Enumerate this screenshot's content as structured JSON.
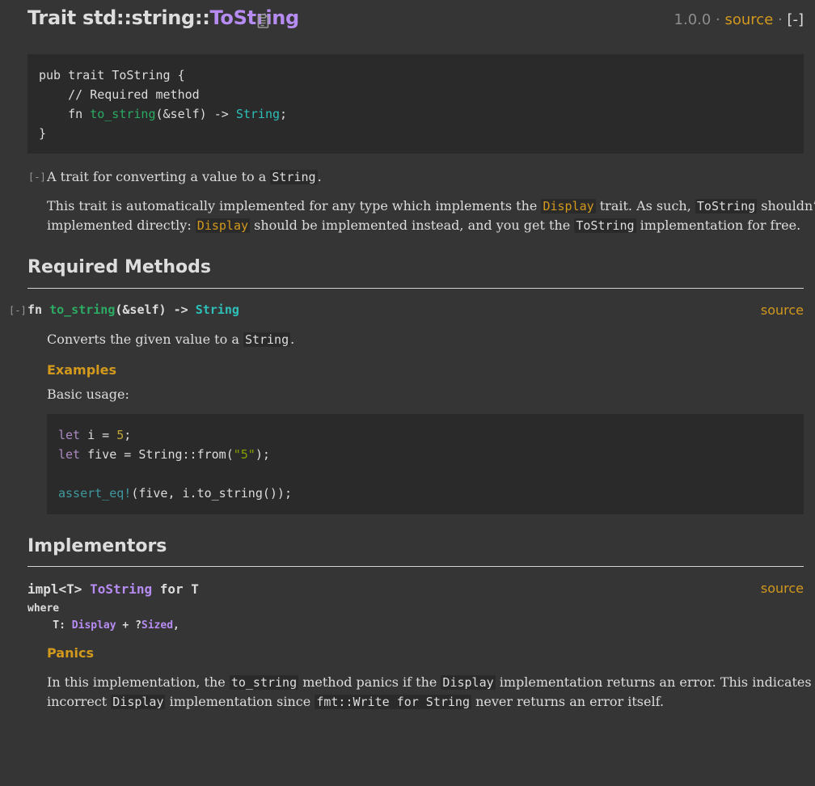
{
  "header": {
    "title_prefix": "Trait std::string::",
    "title_name": "ToString",
    "version": "1.0.0",
    "sep1": " · ",
    "source_label": "source",
    "sep2": " · ",
    "collapse_label": "[-]"
  },
  "declaration": {
    "line1": "pub trait ToString {",
    "line2_comment": "    // Required method",
    "line3_fn": "    fn ",
    "line3_name": "to_string",
    "line3_args": "(&self) -> ",
    "line3_ret": "String",
    "line3_end": ";",
    "line4": "}"
  },
  "description": {
    "toggle": "[-]",
    "summary_a": "A trait for converting a value to a ",
    "summary_code": "String",
    "summary_b": ".",
    "p1_a": "This trait is automatically implemented for any type which implements the ",
    "p1_code1": "Display",
    "p1_b": " trait. As such, ",
    "p1_code2": "ToString",
    "p1_c": " shouldn’t be",
    "p1_d": "implemented directly: ",
    "p1_code3": "Display",
    "p1_e": " should be implemented instead, and you get the ",
    "p1_code4": "ToString",
    "p1_f": " implementation for free."
  },
  "required_methods": {
    "heading": "Required Methods",
    "toggle": "[-]",
    "sig_fn": "fn ",
    "sig_name": "to_string",
    "sig_args": "(&self) -> ",
    "sig_ret": "String",
    "source_label": "source",
    "doc_a": "Converts the given value to a ",
    "doc_code": "String",
    "doc_b": ".",
    "examples_heading": "Examples",
    "basic_usage": "Basic usage:",
    "code": {
      "l1_let": "let",
      "l1_mid": " i = ",
      "l1_num": "5",
      "l1_end": ";",
      "l2_let": "let",
      "l2_mid": " five = String::from(",
      "l2_str": "\"5\"",
      "l2_end": ");",
      "l4_mac": "assert_eq!",
      "l4_rest": "(five, i.to_string());"
    }
  },
  "implementors": {
    "heading": "Implementors",
    "impl_a": "impl<T> ",
    "impl_trait": "ToString",
    "impl_b": " for T",
    "source_label": "source",
    "where_kw": "where",
    "bound_a": "    T: ",
    "bound_trait": "Display",
    "bound_b": " + ?",
    "bound_sized": "Sized",
    "bound_c": ",",
    "panics_heading": "Panics",
    "panics_a": "In this implementation, the ",
    "panics_code1": "to_string",
    "panics_b": " method panics if the ",
    "panics_code2": "Display",
    "panics_c": " implementation returns an error. This indicates an",
    "panics_d": "incorrect ",
    "panics_code3": "Display",
    "panics_e": " implementation since ",
    "panics_code4": "fmt::Write for String",
    "panics_f": " never returns an error itself."
  }
}
